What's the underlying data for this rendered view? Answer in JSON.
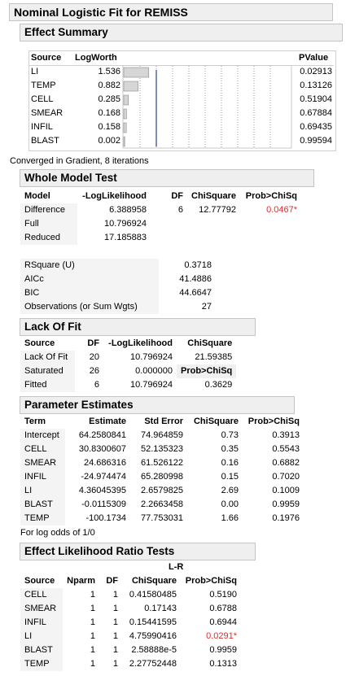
{
  "report_title": "Nominal Logistic Fit for REMISS",
  "effect_summary": {
    "title": "Effect Summary",
    "col_source": "Source",
    "col_logworth": "LogWorth",
    "col_pvalue": "PValue",
    "rows": [
      {
        "source": "LI",
        "logworth": "1.536",
        "pvalue": "0.02913",
        "bar": 1.536
      },
      {
        "source": "TEMP",
        "logworth": "0.882",
        "pvalue": "0.13126",
        "bar": 0.882
      },
      {
        "source": "CELL",
        "logworth": "0.285",
        "pvalue": "0.51904",
        "bar": 0.285
      },
      {
        "source": "SMEAR",
        "logworth": "0.168",
        "pvalue": "0.67884",
        "bar": 0.168
      },
      {
        "source": "INFIL",
        "logworth": "0.158",
        "pvalue": "0.69435",
        "bar": 0.158
      },
      {
        "source": "BLAST",
        "logworth": "0.002",
        "pvalue": "0.99594",
        "bar": 0.002
      }
    ]
  },
  "converged_note": "Converged in Gradient, 8 iterations",
  "whole_model": {
    "title": "Whole Model Test",
    "headers": [
      "Model",
      "-LogLikelihood",
      "DF",
      "ChiSquare",
      "Prob>ChiSq"
    ],
    "rows": [
      {
        "model": "Difference",
        "loglik": "6.388958",
        "df": "6",
        "chisq": "12.77792",
        "prob": "0.0467*"
      },
      {
        "model": "Full",
        "loglik": "10.796924",
        "df": "",
        "chisq": "",
        "prob": ""
      },
      {
        "model": "Reduced",
        "loglik": "17.185883",
        "df": "",
        "chisq": "",
        "prob": ""
      }
    ],
    "stats": [
      {
        "label": "RSquare (U)",
        "value": "0.3718"
      },
      {
        "label": "AICc",
        "value": "41.4886"
      },
      {
        "label": "BIC",
        "value": "44.6647"
      },
      {
        "label": "Observations (or Sum Wgts)",
        "value": "27"
      }
    ]
  },
  "lack_of_fit": {
    "title": "Lack Of Fit",
    "headers": [
      "Source",
      "DF",
      "-LogLikelihood",
      "ChiSquare"
    ],
    "rows": [
      {
        "source": "Lack Of Fit",
        "df": "20",
        "loglik": "10.796924",
        "chisq": "21.59385"
      },
      {
        "source": "Saturated",
        "df": "26",
        "loglik": "0.000000",
        "chisq": "Prob>ChiSq"
      },
      {
        "source": "Fitted",
        "df": "6",
        "loglik": "10.796924",
        "chisq": "0.3629"
      }
    ]
  },
  "parameter_estimates": {
    "title": "Parameter Estimates",
    "headers": [
      "Term",
      "Estimate",
      "Std Error",
      "ChiSquare",
      "Prob>ChiSq"
    ],
    "rows": [
      {
        "term": "Intercept",
        "estimate": "64.2580841",
        "stderr": "74.964859",
        "chisq": "0.73",
        "prob": "0.3913"
      },
      {
        "term": "CELL",
        "estimate": "30.8300607",
        "stderr": "52.135323",
        "chisq": "0.35",
        "prob": "0.5543"
      },
      {
        "term": "SMEAR",
        "estimate": "24.686316",
        "stderr": "61.526122",
        "chisq": "0.16",
        "prob": "0.6882"
      },
      {
        "term": "INFIL",
        "estimate": "-24.974474",
        "stderr": "65.280998",
        "chisq": "0.15",
        "prob": "0.7020"
      },
      {
        "term": "LI",
        "estimate": "4.36045395",
        "stderr": "2.6579825",
        "chisq": "2.69",
        "prob": "0.1009"
      },
      {
        "term": "BLAST",
        "estimate": "-0.0115309",
        "stderr": "2.2663458",
        "chisq": "0.00",
        "prob": "0.9959"
      },
      {
        "term": "TEMP",
        "estimate": "-100.1734",
        "stderr": "77.753031",
        "chisq": "1.66",
        "prob": "0.1976"
      }
    ],
    "note": "For log odds of 1/0"
  },
  "effect_lr": {
    "title": "Effect Likelihood Ratio Tests",
    "lr_label": "L-R",
    "headers": [
      "Source",
      "Nparm",
      "DF",
      "ChiSquare",
      "Prob>ChiSq"
    ],
    "rows": [
      {
        "source": "CELL",
        "nparm": "1",
        "df": "1",
        "chisq": "0.41580485",
        "prob": "0.5190"
      },
      {
        "source": "SMEAR",
        "nparm": "1",
        "df": "1",
        "chisq": "0.17143",
        "prob": "0.6788"
      },
      {
        "source": "INFIL",
        "nparm": "1",
        "df": "1",
        "chisq": "0.15441595",
        "prob": "0.6944"
      },
      {
        "source": "LI",
        "nparm": "1",
        "df": "1",
        "chisq": "4.75990416",
        "prob": "0.0291*"
      },
      {
        "source": "BLAST",
        "nparm": "1",
        "df": "1",
        "chisq": "2.58888e-5",
        "prob": "0.9959"
      },
      {
        "source": "TEMP",
        "nparm": "1",
        "df": "1",
        "chisq": "2.27752448",
        "prob": "0.1313"
      }
    ]
  },
  "colors": {
    "significant": "#d93030",
    "bar_fill": "#d6d6d6",
    "ref_line": "#2a3f8f"
  }
}
